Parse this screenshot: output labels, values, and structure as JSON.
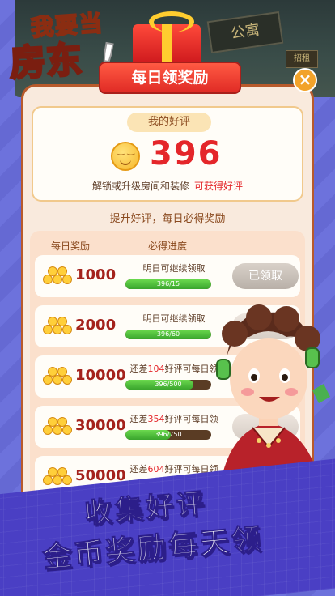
{
  "logo": {
    "line1": "我要当",
    "line2": "房东",
    "bang": "!"
  },
  "game_sign": {
    "main": "公寓",
    "small": "招租"
  },
  "dialog": {
    "title": "每日领奖励",
    "close_label": "×"
  },
  "review": {
    "tag": "我的好评",
    "count": "396",
    "unlock_text": "解锁或升级房间和装修",
    "unlock_highlight": "可获得好评",
    "promote": "提升好评，每日必得奖励"
  },
  "table": {
    "col_reward": "每日奖励",
    "col_progress": "必得进度",
    "rows": [
      {
        "amount": "1000",
        "status": "明日可继续领取",
        "status_prefix": "",
        "status_highlight": "",
        "progress_text": "396/15",
        "progress": 1.0,
        "button": "已领取"
      },
      {
        "amount": "2000",
        "status": "明日可继续领取",
        "status_prefix": "",
        "status_highlight": "",
        "progress_text": "396/60",
        "progress": 1.0,
        "button": ""
      },
      {
        "amount": "10000",
        "status": "好评可每日领",
        "status_prefix": "还差",
        "status_highlight": "104",
        "progress_text": "396/500",
        "progress": 0.792,
        "button": ""
      },
      {
        "amount": "30000",
        "status": "好评可每日领",
        "status_prefix": "还差",
        "status_highlight": "354",
        "progress_text": "396/750",
        "progress": 0.528,
        "button": ""
      },
      {
        "amount": "50000",
        "status": "好评可每日领",
        "status_prefix": "还差",
        "status_highlight": "604",
        "progress_text": "",
        "progress": 0.4,
        "button": ""
      }
    ]
  },
  "banner": {
    "line1": "收集好评",
    "line2": "金币奖励每天领"
  },
  "colors": {
    "accent_red": "#e4262a",
    "bar_green": "#3aa52d",
    "panel_bg": "#f9eadd"
  }
}
